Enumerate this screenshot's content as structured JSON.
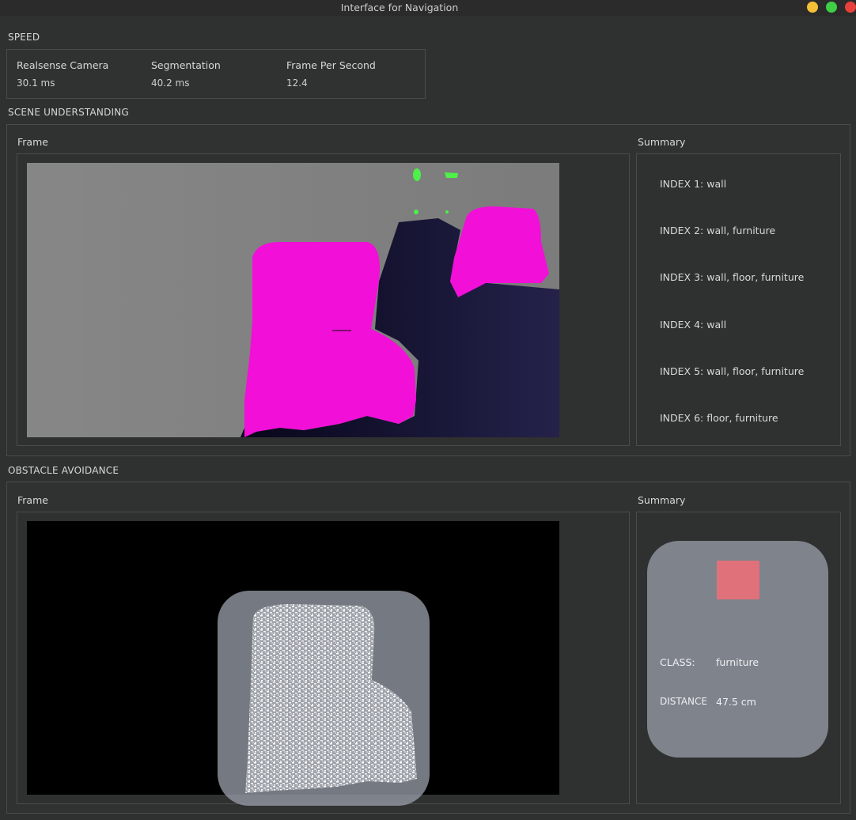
{
  "window": {
    "title": "Interface for Navigation",
    "controls": {
      "minimize": "#f5c035",
      "maximize": "#3fcf45",
      "close": "#e8413b"
    }
  },
  "speed": {
    "heading": "SPEED",
    "metrics": [
      {
        "label": "Realsense Camera",
        "value": "30.1 ms"
      },
      {
        "label": "Segmentation",
        "value": "40.2 ms"
      },
      {
        "label": "Frame Per Second",
        "value": "12.4"
      }
    ]
  },
  "scene": {
    "heading": "SCENE UNDERSTANDING",
    "frame_label": "Frame",
    "summary_label": "Summary",
    "summary": [
      {
        "index": "INDEX 1:",
        "classes": "wall"
      },
      {
        "index": "INDEX 2:",
        "classes": "wall, furniture"
      },
      {
        "index": "INDEX 3:",
        "classes": "wall, floor, furniture"
      },
      {
        "index": "INDEX 4:",
        "classes": "wall"
      },
      {
        "index": "INDEX 5:",
        "classes": "wall, floor, furniture"
      },
      {
        "index": "INDEX 6:",
        "classes": "floor, furniture"
      }
    ],
    "segmentation_colors": {
      "wall": "#808080",
      "furniture": "#f20fd8",
      "floor": "#1a1838",
      "marker": "#4ef04a"
    }
  },
  "obstacle": {
    "heading": "OBSTACLE AVOIDANCE",
    "frame_label": "Frame",
    "summary_label": "Summary",
    "swatch_color": "#e0707a",
    "class_label": "CLASS:",
    "class_value": "furniture",
    "distance_label": "DISTANCE",
    "distance_value": "47.5 cm"
  }
}
